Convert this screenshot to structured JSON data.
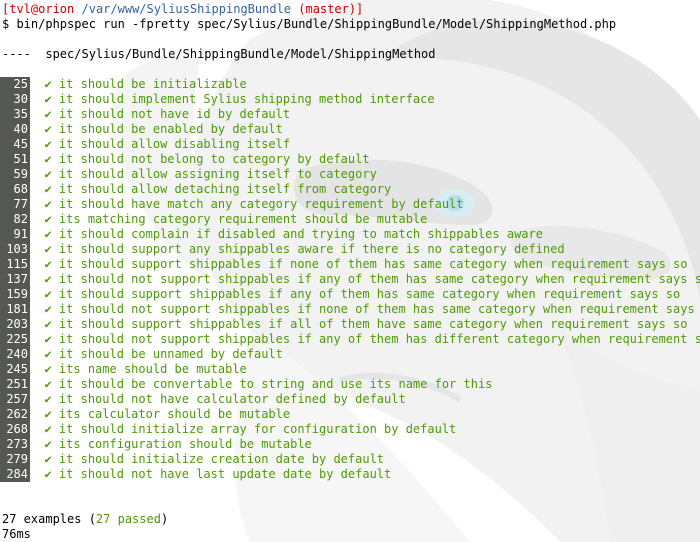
{
  "prompt": {
    "user_host": "tvl@orion",
    "path": "/var/www/SyliusShippingBundle",
    "branch": "(master)",
    "command": "$ bin/phpspec run -fpretty spec/Sylius/Bundle/ShippingBundle/Model/ShippingMethod.php"
  },
  "suite": {
    "dashes": "----",
    "name": "spec/Sylius/Bundle/ShippingBundle/Model/ShippingMethod"
  },
  "check_glyph": "✔",
  "examples": [
    {
      "line": "25",
      "text": "it should be initializable"
    },
    {
      "line": "30",
      "text": "it should implement Sylius shipping method interface"
    },
    {
      "line": "35",
      "text": "it should not have id by default"
    },
    {
      "line": "40",
      "text": "it should be enabled by default"
    },
    {
      "line": "45",
      "text": "it should allow disabling itself"
    },
    {
      "line": "51",
      "text": "it should not belong to category by default"
    },
    {
      "line": "59",
      "text": "it should allow assigning itself to category"
    },
    {
      "line": "68",
      "text": "it should allow detaching itself from category"
    },
    {
      "line": "77",
      "text": "it should have match any category requirement by default"
    },
    {
      "line": "82",
      "text": "its matching category requirement should be mutable"
    },
    {
      "line": "91",
      "text": "it should complain if disabled and trying to match shippables aware"
    },
    {
      "line": "103",
      "text": "it should support any shippables aware if there is no category defined"
    },
    {
      "line": "115",
      "text": "it should support shippables if none of them has same category when requirement says so"
    },
    {
      "line": "137",
      "text": "it should not support shippables if any of them has same category when requirement says so"
    },
    {
      "line": "159",
      "text": "it should support shippables if any of them has same category when requirement says so"
    },
    {
      "line": "181",
      "text": "it should not support shippables if none of them has same category when requirement says so"
    },
    {
      "line": "203",
      "text": "it should support shippables if all of them have same category when requirement says so"
    },
    {
      "line": "225",
      "text": "it should not support shippables if any of them has different category when requirement says"
    },
    {
      "line": "240",
      "text": "it should be unnamed by default"
    },
    {
      "line": "245",
      "text": "its name should be mutable"
    },
    {
      "line": "251",
      "text": "it should be convertable to string and use its name for this"
    },
    {
      "line": "257",
      "text": "it should not have calculator defined by default"
    },
    {
      "line": "262",
      "text": "its calculator should be mutable"
    },
    {
      "line": "268",
      "text": "it should initialize array for configuration by default"
    },
    {
      "line": "273",
      "text": "its configuration should be mutable"
    },
    {
      "line": "279",
      "text": "it should initialize creation date by default"
    },
    {
      "line": "284",
      "text": "it should not have last update date by default"
    }
  ],
  "summary": {
    "count_text": "27 examples (",
    "passed_text": "27 passed",
    "close_paren": ")",
    "time": "76ms"
  },
  "colors": {
    "pass_green": "#4e9a06",
    "prompt_red": "#cc0000",
    "path_blue": "#3465a4",
    "gutter_bg": "#555753"
  }
}
